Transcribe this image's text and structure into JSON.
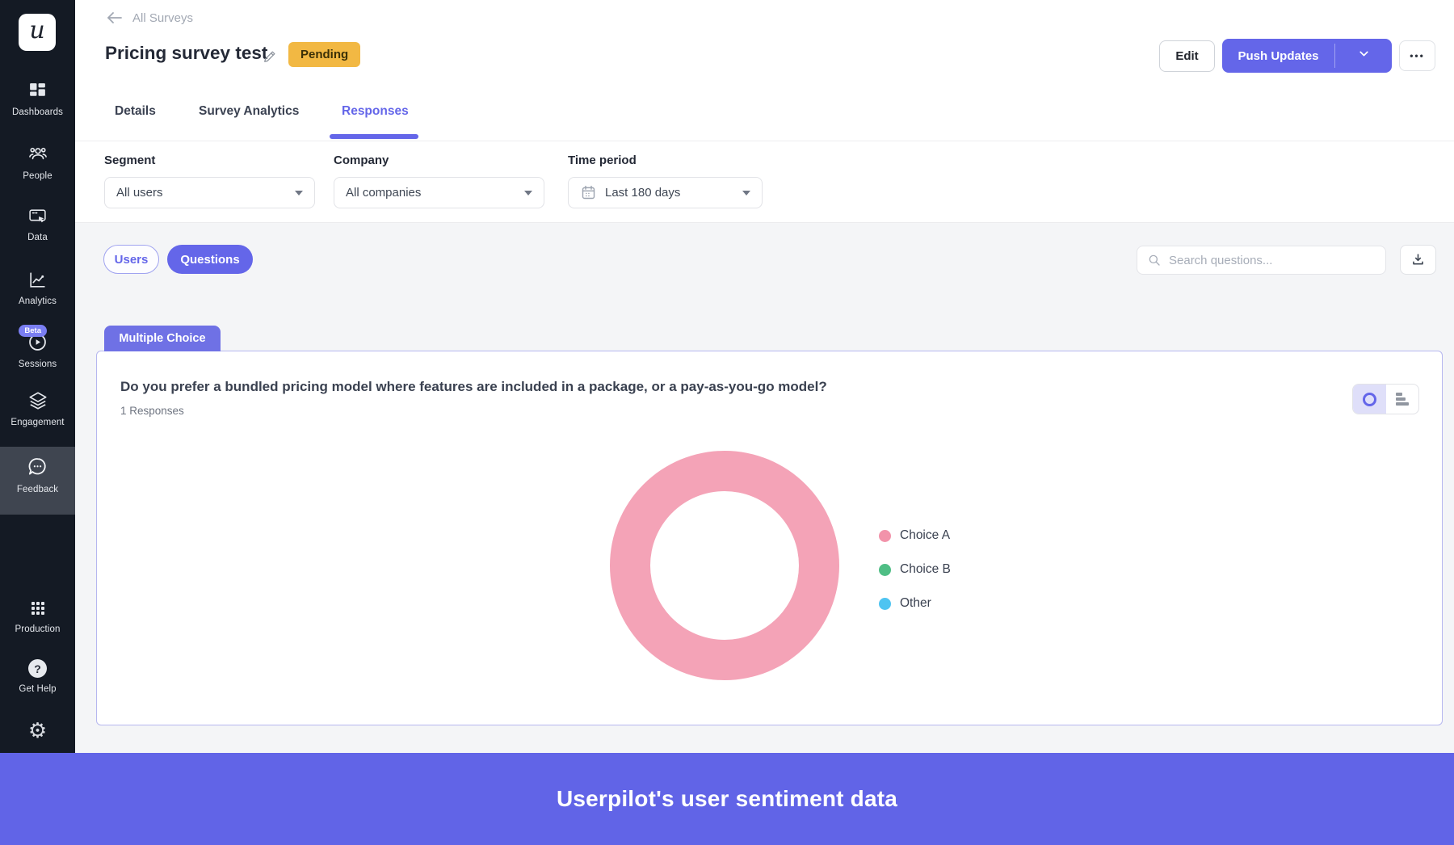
{
  "logo_letter": "u",
  "sidebar": {
    "items": [
      {
        "label": "Dashboards",
        "icon": "dashboards-icon"
      },
      {
        "label": "People",
        "icon": "people-icon"
      },
      {
        "label": "Data",
        "icon": "data-icon"
      },
      {
        "label": "Analytics",
        "icon": "analytics-icon"
      },
      {
        "label": "Sessions",
        "icon": "sessions-icon",
        "badge": "Beta"
      },
      {
        "label": "Engagement",
        "icon": "engagement-icon"
      },
      {
        "label": "Feedback",
        "icon": "feedback-icon",
        "active": true
      }
    ],
    "bottom_items": [
      {
        "label": "Production",
        "icon": "production-icon"
      },
      {
        "label": "Get Help",
        "icon": "help-icon"
      }
    ]
  },
  "header": {
    "breadcrumb": "All Surveys",
    "title": "Pricing survey test",
    "status_badge": "Pending",
    "edit_label": "Edit",
    "push_updates_label": "Push Updates",
    "more_label": "•••"
  },
  "tabs": [
    {
      "label": "Details",
      "active": false
    },
    {
      "label": "Survey Analytics",
      "active": false
    },
    {
      "label": "Responses",
      "active": true
    }
  ],
  "filters": [
    {
      "label": "Segment",
      "value": "All users"
    },
    {
      "label": "Company",
      "value": "All companies"
    },
    {
      "label": "Time period",
      "value": "Last 180 days",
      "icon": "calendar-icon"
    }
  ],
  "toolbar": {
    "users_label": "Users",
    "questions_label": "Questions",
    "search_placeholder": "Search questions..."
  },
  "question_card": {
    "type_tab": "Multiple Choice",
    "question": "Do you prefer a bundled pricing model where features are included in a package, or a pay-as-you-go model?",
    "responses_count": "1 Responses"
  },
  "chart_data": {
    "type": "pie",
    "subtype": "donut",
    "title": "Do you prefer a bundled pricing model where features are included in a package, or a pay-as-you-go model?",
    "labels": [
      "Choice A",
      "Choice B",
      "Other"
    ],
    "values_pct": [
      100,
      0,
      0
    ],
    "colors": [
      "#F293AA",
      "#4FBE85",
      "#4EC4F1"
    ],
    "legend_position": "right",
    "total_responses": 1
  },
  "banner": {
    "text": "Userpilot's user sentiment data"
  },
  "colors": {
    "accent_purple": "#6466E9",
    "banner_purple": "#6164E7",
    "pending_yellow": "#F2B843",
    "sidebar_dark": "#141A24",
    "chart_pink": "#F293AA",
    "chart_green": "#4FBE85",
    "chart_blue": "#4EC4F1"
  }
}
